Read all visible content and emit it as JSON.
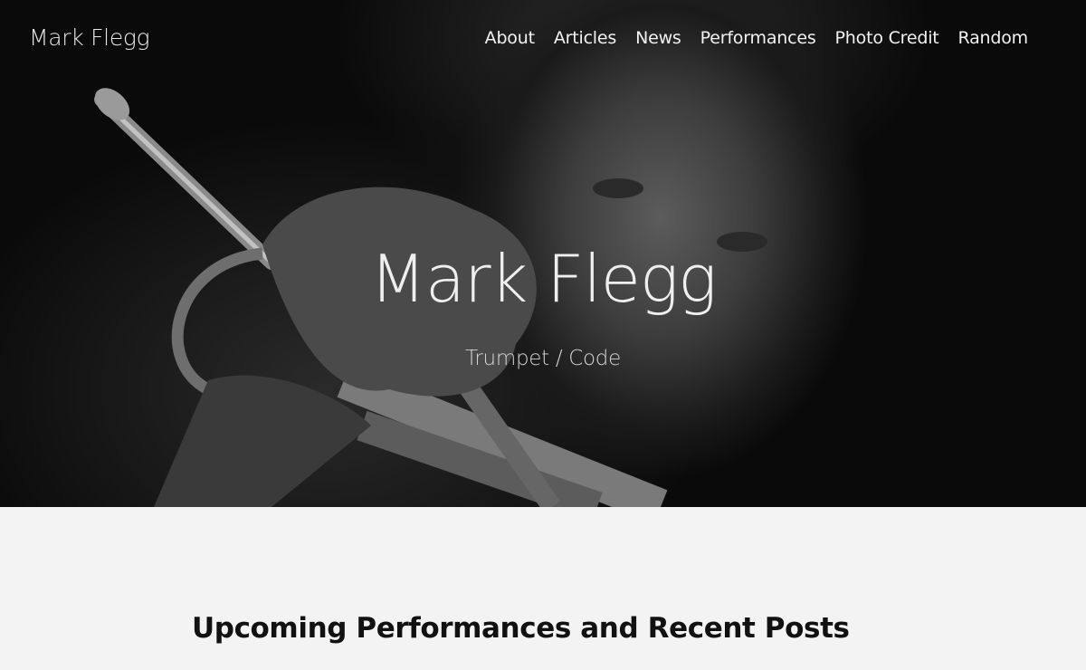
{
  "header": {
    "logo": "Mark Flegg",
    "nav": [
      {
        "label": "About"
      },
      {
        "label": "Articles"
      },
      {
        "label": "News"
      },
      {
        "label": "Performances"
      },
      {
        "label": "Photo Credit"
      },
      {
        "label": "Random"
      }
    ]
  },
  "hero": {
    "title": "Mark Flegg",
    "subtitle": "Trumpet / Code"
  },
  "main": {
    "section_heading": "Upcoming Performances and Recent Posts"
  }
}
